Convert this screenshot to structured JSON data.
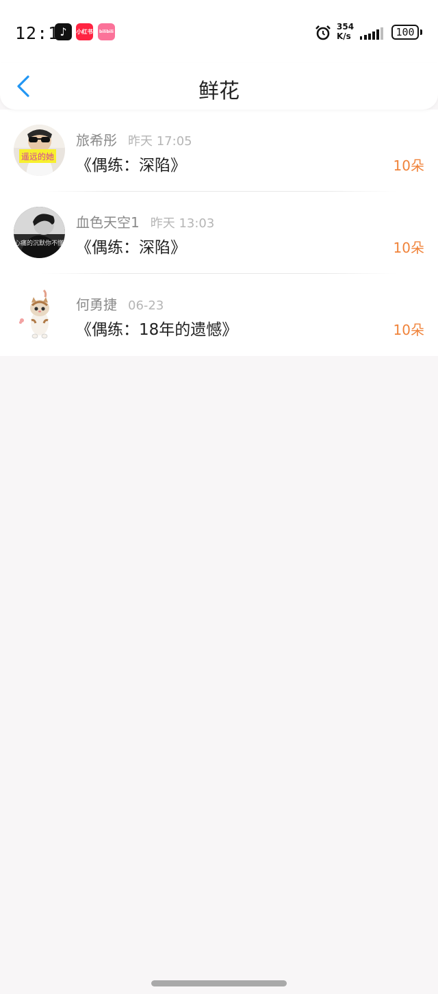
{
  "status_bar": {
    "time": "12:19",
    "apps": [
      "tiktok-icon",
      "xiaohongshu-icon",
      "bilibili-icon"
    ],
    "xhs_label": "小红书",
    "bili_label": "bilibili",
    "net_speed_value": "354",
    "net_speed_unit": "K/s",
    "battery": "100",
    "icons": [
      "alarm-icon",
      "signal-icon",
      "battery-icon"
    ]
  },
  "header": {
    "title": "鲜花",
    "back_icon": "chevron-left-icon",
    "accent_color": "#2196f3"
  },
  "items": [
    {
      "user": "旅希彤",
      "time": "昨天 17:05",
      "book": "《偶练：深陷》",
      "flowers": "10朵",
      "avatar_caption": "遥远的她"
    },
    {
      "user": "血色天空1",
      "time": "昨天 13:03",
      "book": "《偶练：深陷》",
      "flowers": "10朵",
      "avatar_caption": "心痛的沉默你不懂"
    },
    {
      "user": "何勇捷",
      "time": "06-23",
      "book": "《偶练：18年的遗憾》",
      "flowers": "10朵"
    }
  ],
  "colors": {
    "flower_count": "#f0833a",
    "name": "#8a8a8a",
    "time": "#b5b5b5",
    "background": "#f8f6f7"
  }
}
